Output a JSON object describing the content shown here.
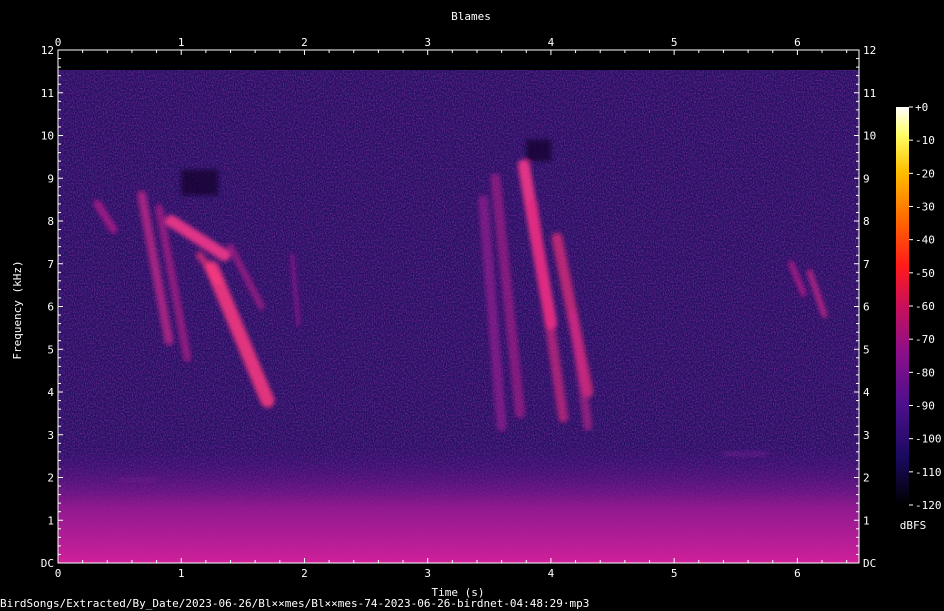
{
  "chart_data": {
    "type": "heatmap",
    "title": "Blames",
    "xlabel": "Time (s)",
    "ylabel": "Frequency (kHz)",
    "xlim": [
      0,
      6.5
    ],
    "ylim": [
      0,
      12
    ],
    "x_ticks": [
      "0",
      "1",
      "2",
      "3",
      "4",
      "5",
      "6"
    ],
    "y_ticks": [
      "DC",
      "1",
      "2",
      "3",
      "4",
      "5",
      "6",
      "7",
      "8",
      "9",
      "10",
      "11",
      "12"
    ],
    "colorbar": {
      "unit": "dBFS",
      "range": [
        -120,
        0
      ],
      "ticks": [
        "+0",
        "-10",
        "-20",
        "-30",
        "-40",
        "-50",
        "-60",
        "-70",
        "-80",
        "-90",
        "-100",
        "-110",
        "-120"
      ],
      "colors": [
        "#000000",
        "#1a0a5e",
        "#4b0f8c",
        "#8a0f8a",
        "#c8105a",
        "#ff1a1a",
        "#ff6a00",
        "#ffc000",
        "#ffff66",
        "#ffffff"
      ]
    },
    "grid": false
  },
  "footer": {
    "path": "BirdSongs/Extracted/By_Date/2023-06-26/Bl××mes/Bl××mes-74-2023-06-26-birdnet-04:48:29·mp3"
  },
  "colors": {
    "background": "#000000",
    "axis": "#ffffff",
    "noise_floor": "#2a0d6b",
    "low_band": "#b0209a",
    "call": "#ff3a8c"
  }
}
